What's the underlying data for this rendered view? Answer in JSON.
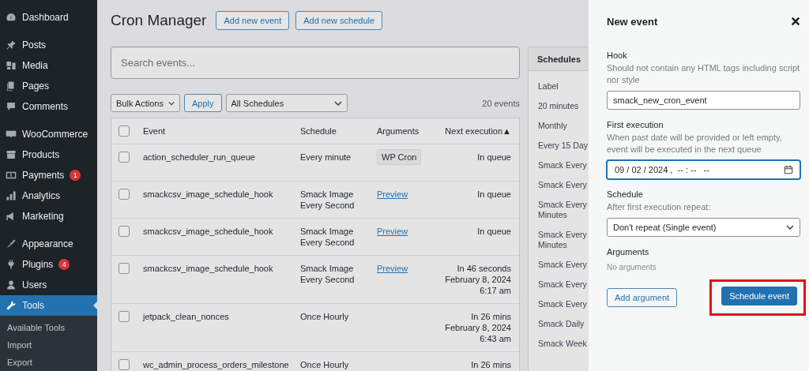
{
  "sidebar": {
    "groups": [
      [
        {
          "label": "Dashboard",
          "selected": false
        }
      ],
      [
        {
          "label": "Posts",
          "selected": false
        },
        {
          "label": "Media",
          "selected": false
        },
        {
          "label": "Pages",
          "selected": false
        },
        {
          "label": "Comments",
          "selected": false
        }
      ],
      [
        {
          "label": "WooCommerce",
          "selected": false
        },
        {
          "label": "Products",
          "selected": false
        },
        {
          "label": "Payments",
          "selected": false,
          "badge": "1"
        },
        {
          "label": "Analytics",
          "selected": false
        },
        {
          "label": "Marketing",
          "selected": false
        }
      ],
      [
        {
          "label": "Appearance",
          "selected": false
        },
        {
          "label": "Plugins",
          "selected": false,
          "badge": "4"
        },
        {
          "label": "Users",
          "selected": false
        },
        {
          "label": "Tools",
          "selected": true,
          "submenu": [
            "Available Tools",
            "Import",
            "Export"
          ]
        }
      ]
    ]
  },
  "page": {
    "title": "Cron Manager",
    "buttons": [
      "Add new event",
      "Add new schedule"
    ],
    "search": {
      "placeholder": "Search events..."
    },
    "bulk_actions": {
      "value": "Bulk Actions"
    },
    "apply_button": "Apply",
    "schedule_filter": {
      "value": "All Schedules"
    },
    "event_count": "20 events",
    "table": {
      "select_all_checked": false,
      "columns": [
        {
          "label": "Event"
        },
        {
          "label": "Schedule"
        },
        {
          "label": "Arguments"
        },
        {
          "label": "Next execution",
          "sort_indicator": "▲"
        }
      ],
      "rows": [
        {
          "checked": false,
          "event": "action_scheduler_run_queue",
          "schedule": "Every minute",
          "arguments": {
            "kind": "tag",
            "text": "WP Cron"
          },
          "next_execution": [
            "In queue"
          ]
        },
        {
          "checked": false,
          "event": "smackcsv_image_schedule_hook",
          "schedule": "Smack Image Every Second",
          "arguments": {
            "kind": "link",
            "text": "Preview"
          },
          "next_execution": [
            "In queue"
          ]
        },
        {
          "checked": false,
          "event": "smackcsv_image_schedule_hook",
          "schedule": "Smack Image Every Second",
          "arguments": {
            "kind": "link",
            "text": "Preview"
          },
          "next_execution": [
            "In queue"
          ]
        },
        {
          "checked": false,
          "event": "smackcsv_image_schedule_hook",
          "schedule": "Smack Image Every Second",
          "arguments": {
            "kind": "link",
            "text": "Preview"
          },
          "next_execution": [
            "In 46 seconds",
            "February 8, 2024",
            "6:17 am"
          ]
        },
        {
          "checked": false,
          "event": "jetpack_clean_nonces",
          "schedule": "Once Hourly",
          "next_execution": [
            "In 26 mins",
            "February 8, 2024",
            "6:43 am"
          ]
        },
        {
          "checked": false,
          "event": "wc_admin_process_orders_milestone",
          "schedule": "Once Hourly",
          "next_execution": [
            "In 26 mins"
          ]
        }
      ]
    }
  },
  "schedules": {
    "title": "Schedules",
    "header": "Label",
    "items": [
      "20 minutes",
      "Monthly",
      "Every 15 Day",
      "Smack Every",
      "Smack Every",
      "Smack Every Minutes",
      "Smack Every Minutes",
      "Smack Every",
      "Smack Every",
      "Smack Every",
      "Smack Daily",
      "Smack Week"
    ]
  },
  "new_event": {
    "title": "New event",
    "hook": {
      "label": "Hook",
      "help": "Should not contain any HTML tags including script nor style",
      "value": "smack_new_cron_event"
    },
    "first_execution": {
      "label": "First execution",
      "help": "When past date will be provided or left empty, event will be executed in the next queue",
      "value": "09 / 02 / 2024 ,  -- : --   --"
    },
    "schedule": {
      "label": "Schedule",
      "help": "After first execution repeat:",
      "value": "Don't repeat (Single event)"
    },
    "arguments": {
      "label": "Arguments",
      "empty_text": "No arguments"
    },
    "add_argument_button": "Add argument",
    "schedule_button": {
      "label": "Schedule event",
      "highlighted": true
    }
  }
}
